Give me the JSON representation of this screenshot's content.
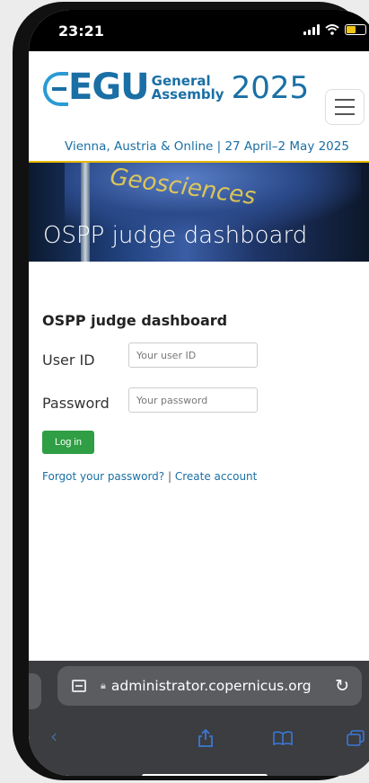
{
  "status_bar": {
    "time": "23:21"
  },
  "header": {
    "logo_text": "EGU",
    "logo_line1": "General",
    "logo_line2": "Assembly",
    "year": "2025",
    "tagline": "Vienna, Austria & Online | 27 April–2 May 2025"
  },
  "banner": {
    "title": "OSPP judge dashboard",
    "deco": "Geosciences"
  },
  "login": {
    "heading": "OSPP judge dashboard",
    "user_id_label": "User ID",
    "user_id_placeholder": "Your user ID",
    "password_label": "Password",
    "password_placeholder": "Your password",
    "login_button": "Log in",
    "forgot_link": "Forgot your password?",
    "separator": "|",
    "create_link": "Create account"
  },
  "browser": {
    "url": "administrator.copernicus.org"
  },
  "icons": {
    "menu": "hamburger-menu-icon",
    "reload": "reload-icon",
    "back": "back-icon",
    "share": "share-icon",
    "bookmarks": "bookmarks-icon",
    "tabs": "tabs-icon"
  },
  "colors": {
    "brand_blue": "#1a6fa5",
    "login_green": "#2f9e44",
    "banner_accent": "#e8b800"
  }
}
